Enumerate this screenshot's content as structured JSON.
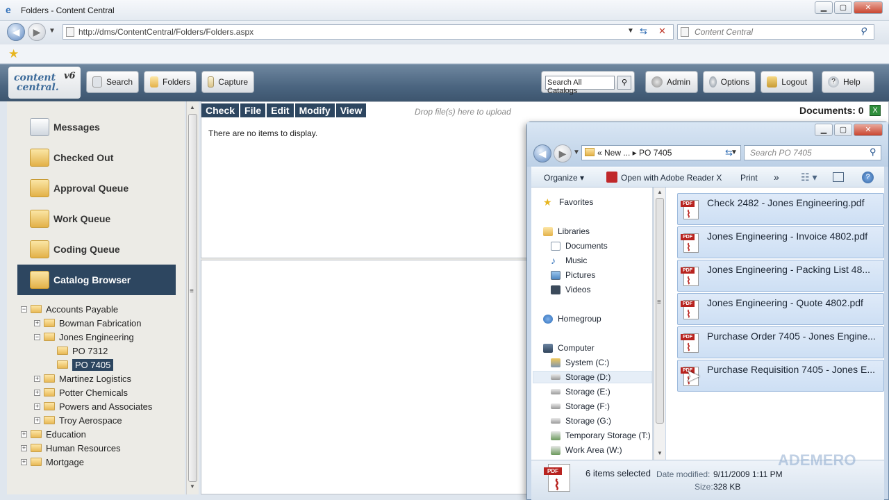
{
  "browser": {
    "window_title": "Folders - Content Central",
    "url": "http://dms/ContentCentral/Folders/Folders.aspx",
    "search_placeholder": "Content Central"
  },
  "app": {
    "logo_line1": "content",
    "logo_line2": "central.",
    "logo_version": "v6",
    "header_buttons": {
      "search": "Search",
      "folders": "Folders",
      "capture": "Capture",
      "admin": "Admin",
      "options": "Options",
      "logout": "Logout",
      "help": "Help"
    },
    "catalog_search_value": "Search All Catalogs"
  },
  "sidebar": {
    "nav": [
      {
        "label": "Messages"
      },
      {
        "label": "Checked Out"
      },
      {
        "label": "Approval Queue"
      },
      {
        "label": "Work Queue"
      },
      {
        "label": "Coding Queue"
      },
      {
        "label": "Catalog Browser"
      }
    ],
    "tree": [
      {
        "label": "Accounts Payable",
        "toggle": "−"
      },
      {
        "label": "Bowman Fabrication",
        "toggle": "+"
      },
      {
        "label": "Jones Engineering",
        "toggle": "−"
      },
      {
        "label": "PO 7312",
        "toggle": ""
      },
      {
        "label": "PO 7405",
        "toggle": ""
      },
      {
        "label": "Martinez Logistics",
        "toggle": "+"
      },
      {
        "label": "Potter Chemicals",
        "toggle": "+"
      },
      {
        "label": "Powers and Associates",
        "toggle": "+"
      },
      {
        "label": "Troy Aerospace",
        "toggle": "+"
      },
      {
        "label": "Education",
        "toggle": "+"
      },
      {
        "label": "Human Resources",
        "toggle": "+"
      },
      {
        "label": "Mortgage",
        "toggle": "+"
      }
    ]
  },
  "main": {
    "toolbar": [
      "Check",
      "File",
      "Edit",
      "Modify",
      "View"
    ],
    "drop_hint": "Drop file(s) here to upload",
    "empty_message": "There are no items to display.",
    "documents_count": "Documents: 0"
  },
  "explorer": {
    "breadcrumb": "«  New ...  ▸  PO 7405",
    "search_placeholder": "Search PO 7405",
    "commands": {
      "organize": "Organize",
      "open_with": "Open with Adobe Reader X",
      "print": "Print",
      "more": "»"
    },
    "nav": {
      "favorites": "Favorites",
      "libraries": "Libraries",
      "documents": "Documents",
      "music": "Music",
      "pictures": "Pictures",
      "videos": "Videos",
      "homegroup": "Homegroup",
      "computer": "Computer",
      "drives": [
        "System (C:)",
        "Storage (D:)",
        "Storage (E:)",
        "Storage (F:)",
        "Storage (G:)",
        "Temporary Storage (T:)",
        "Work Area (W:)"
      ]
    },
    "files": [
      "Check 2482 - Jones Engineering.pdf",
      "Jones Engineering - Invoice 4802.pdf",
      "Jones Engineering - Packing List 48...",
      "Jones Engineering - Quote 4802.pdf",
      "Purchase Order 7405 - Jones Engine...",
      "Purchase Requisition 7405 - Jones E..."
    ],
    "details": {
      "selected": "6 items selected",
      "modified_label": "Date modified:",
      "modified_value": "9/11/2009 1:11 PM",
      "size_label": "Size:",
      "size_value": "328 KB"
    }
  },
  "watermark": "ADEMERO"
}
